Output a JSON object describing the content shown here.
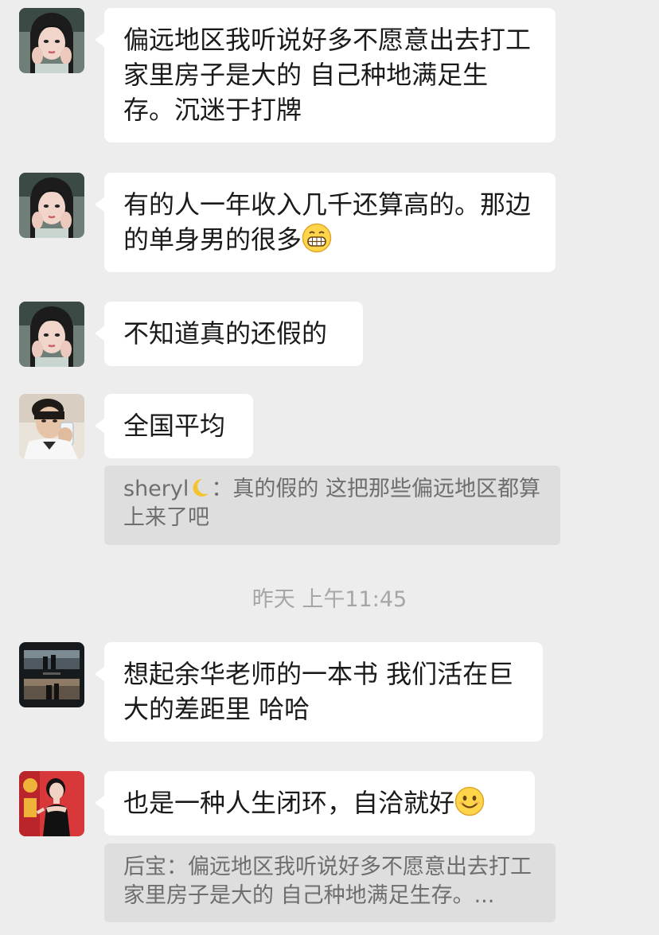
{
  "messages": [
    {
      "id": "m1",
      "avatar": "woman-ancient-costume-avatar",
      "text": "偏远地区我听说好多不愿意出去打工 家里房子是大的 自己种地满足生存。沉迷于打牌"
    },
    {
      "id": "m2",
      "avatar": "woman-ancient-costume-avatar",
      "text": "有的人一年收入几千还算高的。那边的单身男的很多",
      "emoji": "grinning-teeth-emoji"
    },
    {
      "id": "m3",
      "avatar": "woman-ancient-costume-avatar",
      "text": "不知道真的还假的"
    },
    {
      "id": "m4",
      "avatar": "man-drinking-avatar",
      "text": "全国平均",
      "quote": {
        "sender": "sheryl",
        "sender_icon": "crescent-moon-emoji",
        "separator": "：",
        "text": "真的假的 这把那些偏远地区都算上来了吧"
      }
    },
    {
      "id": "m5",
      "avatar": "movie-stills-avatar",
      "text": " 想起余华老师的一本书 我们活在巨大的差距里 哈哈"
    },
    {
      "id": "m6",
      "avatar": "woman-black-dress-avatar",
      "text": "也是一种人生闭环，自洽就好",
      "emoji": "smiling-face-emoji",
      "quote": {
        "sender": "后宝",
        "separator": "：",
        "text": "偏远地区我听说好多不愿意出去打工 家里房子是大的 自己种地满足生存。..."
      }
    }
  ],
  "timestamp": "昨天 上午11:45",
  "colors": {
    "background": "#ededed",
    "bubble": "#ffffff",
    "quote_background": "#dedede",
    "quote_text": "#6e6e6e",
    "timestamp_text": "#a6a6a6"
  }
}
